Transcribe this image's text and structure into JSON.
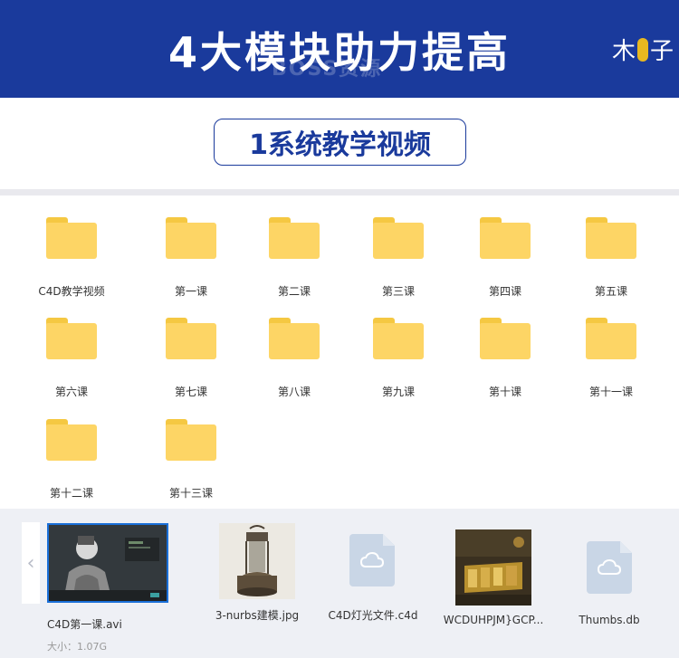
{
  "banner": {
    "title": "4大模块助力提高",
    "watermark": "BOSS资源",
    "brand_left": "木",
    "brand_right": "子"
  },
  "section": {
    "title": "1系统教学视频"
  },
  "folders": [
    "C4D教学视频",
    "第一课",
    "第二课",
    "第三课",
    "第四课",
    "第五课",
    "第六课",
    "第七课",
    "第八课",
    "第九课",
    "第十课",
    "第十一课",
    "第十二课",
    "第十三课"
  ],
  "files": [
    {
      "name": "C4D第一课.avi",
      "size": "大小：1.07G",
      "type": "video",
      "selected": true
    },
    {
      "name": "3-nurbs建模.jpg",
      "type": "image"
    },
    {
      "name": "C4D灯光文件.c4d",
      "type": "cloud-doc"
    },
    {
      "name": "WCDUHPJM}GCP...",
      "type": "image"
    },
    {
      "name": "Thumbs.db",
      "type": "cloud-doc"
    }
  ],
  "colors": {
    "banner": "#1a3a9c",
    "folder": "#fdd565",
    "strip": "#eef0f5",
    "selected": "#1a6fd8"
  }
}
